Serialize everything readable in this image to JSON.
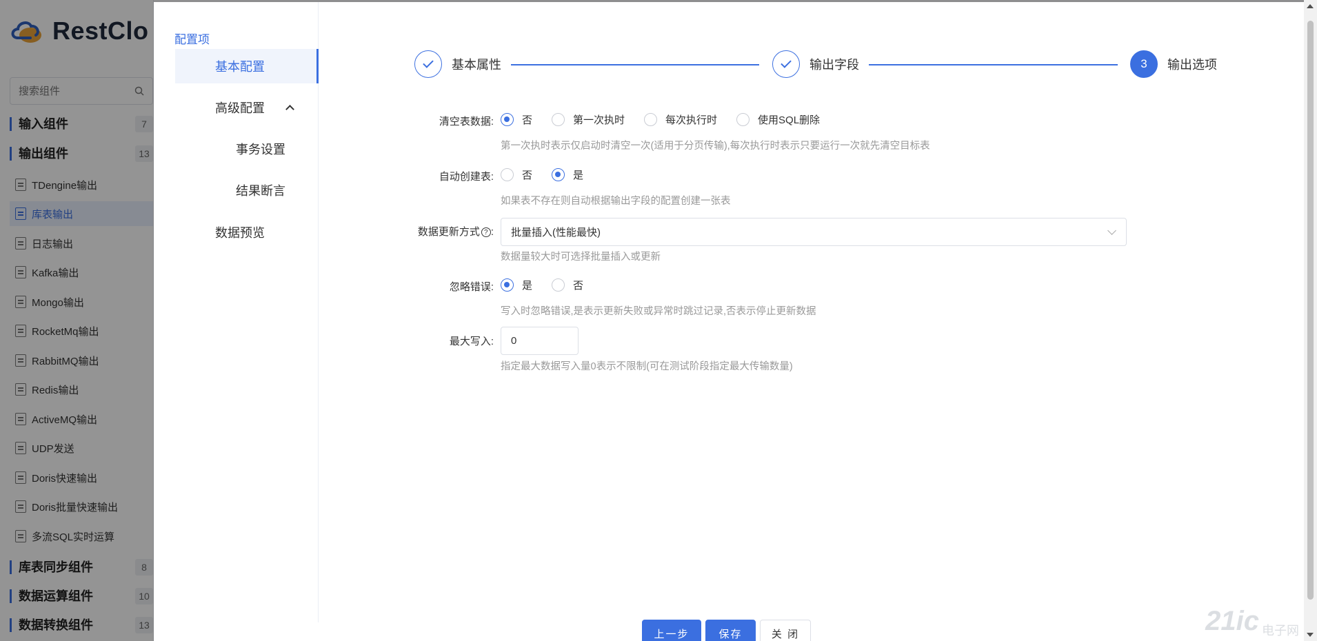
{
  "background": {
    "logo_text": "RestClo",
    "search_placeholder": "搜索组件",
    "groups": [
      {
        "label": "输入组件",
        "count": "7"
      },
      {
        "label": "输出组件",
        "count": "13"
      },
      {
        "label": "库表同步组件",
        "count": "8"
      },
      {
        "label": "数据运算组件",
        "count": "10"
      },
      {
        "label": "数据转换组件",
        "count": "13"
      }
    ],
    "components": [
      {
        "label": "TDengine输出"
      },
      {
        "label": "库表输出"
      },
      {
        "label": "日志输出"
      },
      {
        "label": "Kafka输出"
      },
      {
        "label": "Mongo输出"
      },
      {
        "label": "RocketMq输出"
      },
      {
        "label": "RabbitMQ输出"
      },
      {
        "label": "Redis输出"
      },
      {
        "label": "ActiveMQ输出"
      },
      {
        "label": "UDP发送"
      },
      {
        "label": "Doris快速输出"
      },
      {
        "label": "Doris批量快速输出"
      },
      {
        "label": "多流SQL实时运算"
      }
    ],
    "active_component": "库表输出"
  },
  "config": {
    "title": "配置项",
    "items": [
      {
        "label": "基本配置"
      },
      {
        "label": "高级配置"
      },
      {
        "label": "事务设置"
      },
      {
        "label": "结果断言"
      },
      {
        "label": "数据预览"
      }
    ]
  },
  "steps": [
    {
      "label": "基本属性",
      "status": "done"
    },
    {
      "label": "输出字段",
      "status": "done"
    },
    {
      "label": "输出选项",
      "number": "3",
      "status": "current"
    }
  ],
  "form": {
    "clear_table": {
      "label": "清空表数据:",
      "options": [
        "否",
        "第一次执时",
        "每次执行时",
        "使用SQL删除"
      ],
      "selected": "否",
      "hint": "第一次执时表示仅启动时清空一次(适用于分页传输),每次执行时表示只要运行一次就先清空目标表"
    },
    "auto_create": {
      "label": "自动创建表:",
      "options": [
        "否",
        "是"
      ],
      "selected": "是",
      "hint": "如果表不存在则自动根据输出字段的配置创建一张表"
    },
    "update_mode": {
      "label": "数据更新方式",
      "label_suffix": ":",
      "value": "批量插入(性能最快)",
      "hint": "数据量较大时可选择批量插入或更新"
    },
    "ignore_error": {
      "label": "忽略错误:",
      "options": [
        "是",
        "否"
      ],
      "selected": "是",
      "hint": "写入时忽略错误,是表示更新失败或异常时跳过记录,否表示停止更新数据"
    },
    "max_write": {
      "label": "最大写入:",
      "value": "0",
      "hint": "指定最大数据写入量0表示不限制(可在测试阶段指定最大传输数量)"
    }
  },
  "footer": {
    "prev": "上一步",
    "save": "保存",
    "close": "关 闭"
  },
  "watermark": {
    "big": "21ic",
    "small": "电子网"
  },
  "colors": {
    "accent": "#3b6fe0",
    "overlay": "rgba(0,0,0,0.42)"
  }
}
